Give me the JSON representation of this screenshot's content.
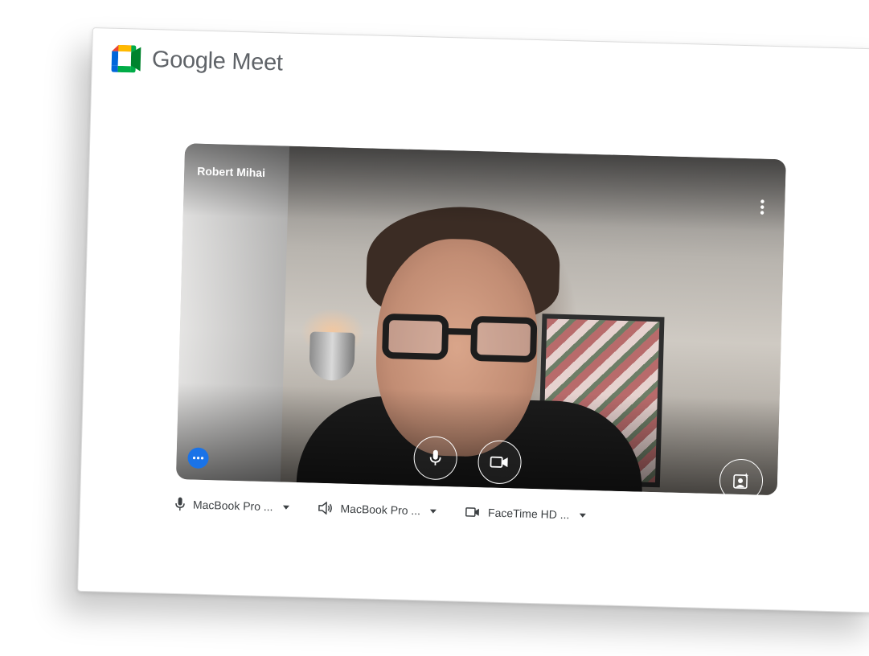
{
  "app": {
    "brand_google": "Google",
    "brand_meet": "Meet"
  },
  "preview": {
    "participant_name": "Robert Mihai"
  },
  "devices": {
    "microphone": "MacBook Pro ...",
    "speaker": "MacBook Pro ...",
    "camera": "FaceTime HD ..."
  },
  "colors": {
    "accent_blue": "#1a73e8",
    "text_gray": "#5f6368",
    "logo_green": "#00ac47",
    "logo_yellow": "#ffba00",
    "logo_blue": "#0066da",
    "logo_red": "#ea4335"
  },
  "icons": {
    "mic": "mic-icon",
    "camera": "camera-icon",
    "speaker": "speaker-icon",
    "more": "more-vert-icon",
    "effects": "person-sparkle-icon",
    "visual": "more-horiz-icon"
  }
}
